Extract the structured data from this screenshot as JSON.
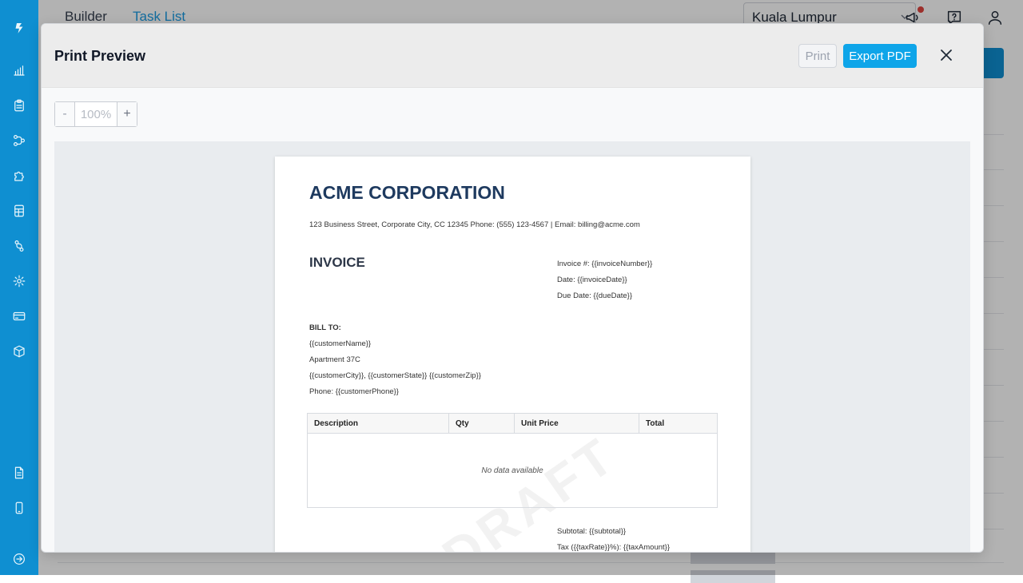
{
  "header": {
    "tabs": [
      {
        "label": "Builder",
        "active": false
      },
      {
        "label": "Task List",
        "active": true
      }
    ],
    "location": "Kuala Lumpur"
  },
  "colors": {
    "rail": "#0f8fd1",
    "accent": "#1a9be3",
    "export_button": "#0ea5e9",
    "invoice_heading": "#1e3a5f"
  },
  "modal": {
    "title": "Print Preview",
    "print_label": "Print",
    "export_label": "Export PDF",
    "zoom": {
      "minus": "-",
      "value": "100%",
      "plus": "+"
    }
  },
  "invoice": {
    "company": "ACME CORPORATION",
    "address": "123 Business Street, Corporate City, CC 12345 Phone: (555) 123-4567 | Email: billing@acme.com",
    "title": "INVOICE",
    "meta": [
      "Invoice #: {{invoiceNumber}}",
      "Date: {{invoiceDate}}",
      "Due Date: {{dueDate}}"
    ],
    "bill_to_label": "BILL TO:",
    "bill_to": [
      "{{customerName}}",
      "Apartment 37C",
      "{{customerCity}}, {{customerState}} {{customerZip}}",
      "Phone: {{customerPhone}}"
    ],
    "table": {
      "headers": [
        "Description",
        "Qty",
        "Unit Price",
        "Total"
      ],
      "empty_text": "No data available"
    },
    "totals": [
      "Subtotal: {{subtotal}}",
      "Tax ({{taxRate}}%): {{taxAmount}}"
    ]
  }
}
